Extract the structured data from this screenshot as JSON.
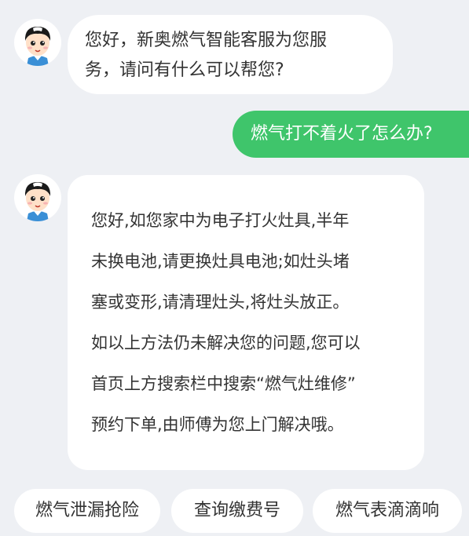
{
  "chat": {
    "bot_greeting": [
      "您好，新奥燃气智能客服为您服",
      "务，请问有什么可以帮您?"
    ],
    "user_question": "燃气打不着火了怎么办?",
    "bot_answer": [
      "您好,如您家中为电子打火灶具,半年",
      "未换电池,请更换灶具电池;如灶头堵",
      "塞或变形,请清理灶头,将灶头放正。",
      "如以上方法仍未解决您的问题,您可以",
      "首页上方搜索栏中搜索“燃气灶维修”",
      "预约下单,由师傅为您上门解决哦。"
    ],
    "bot_avatar_icon": "customer-service-agent-avatar"
  },
  "quick_replies": [
    "燃气泄漏抢险",
    "查询缴费号",
    "燃气表滴滴响"
  ],
  "colors": {
    "background": "#eef0f4",
    "user_bubble": "#3fc56b",
    "bot_bubble": "#ffffff",
    "text": "#333333"
  }
}
